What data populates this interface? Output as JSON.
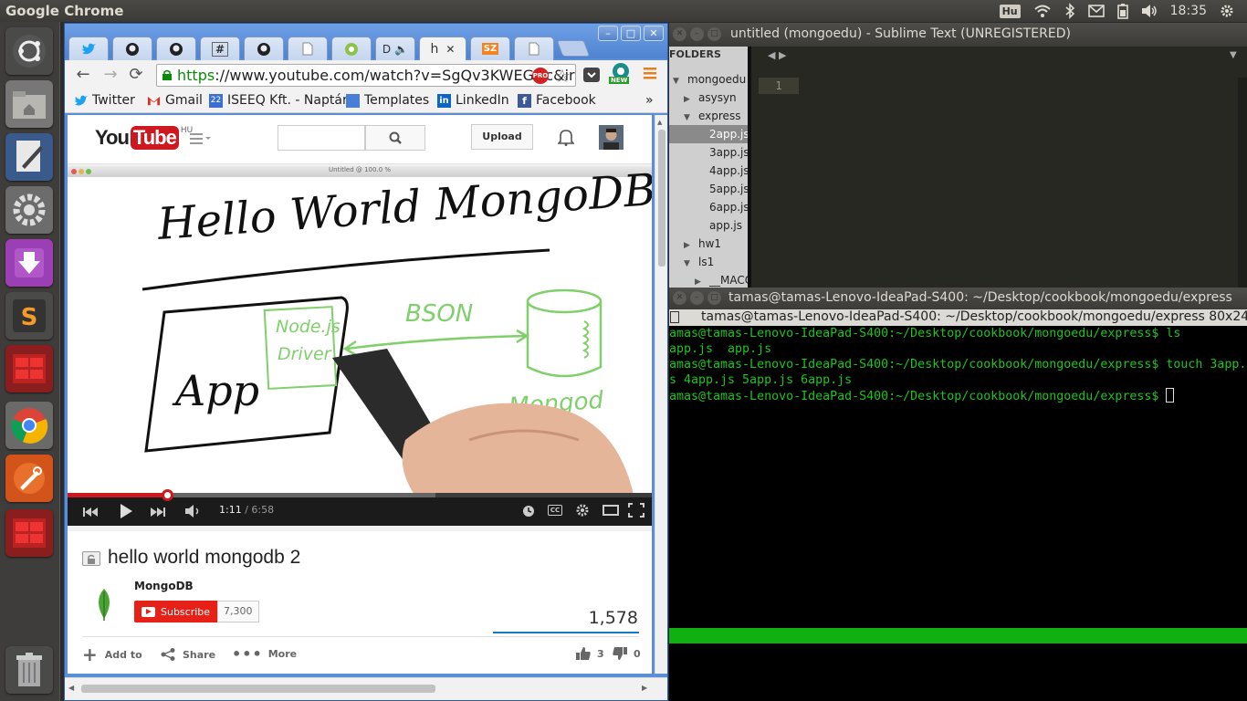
{
  "topbar": {
    "app_name": "Google Chrome",
    "keyboard": "Hu",
    "time": "18:35"
  },
  "launcher": {
    "items": [
      "ubuntu-dash",
      "files",
      "text-editor",
      "settings",
      "ubuntu-software",
      "sublime-text",
      "terminal",
      "chrome",
      "inkscape",
      "terminal-2",
      "trash"
    ]
  },
  "chrome": {
    "tabs": [
      "",
      "",
      "",
      "#",
      "",
      "",
      "",
      "D",
      "h",
      "SZ",
      ""
    ],
    "active_tab": "h",
    "url_https": "https",
    "url_rest": "://www.youtube.com/watch?v=SgQv3KWEGDc&ir",
    "bookmarks": [
      "Twitter",
      "Gmail",
      "ISEEQ Kft. - Naptár",
      "Templates",
      "LinkedIn",
      "Facebook"
    ],
    "bookmarks_more": "»",
    "new_badge": "NEW"
  },
  "youtube": {
    "logo_you": "You",
    "logo_tube": "Tube",
    "region": "HU",
    "upload": "Upload",
    "video_window_title": "Untitled @ 100.0 %",
    "time_current": "1:11",
    "time_total": "/ 6:58",
    "progress": 0.17,
    "buffered": 0.63,
    "title": "hello world mongodb 2",
    "channel": "MongoDB",
    "subscribe": "Subscribe",
    "subscriber_count": "7,300",
    "views": "1,578",
    "actions": {
      "add_to": "Add to",
      "share": "Share",
      "more": "More"
    },
    "likes": "3",
    "dislikes": "0",
    "whiteboard": {
      "heading": "Hello World MongoDB",
      "app": "App",
      "driver_line1": "Node.js",
      "driver_line2": "Driver",
      "bson": "BSON",
      "mongod": "Mongod"
    }
  },
  "sublime": {
    "title": "untitled (mongoedu) - Sublime Text (UNREGISTERED)",
    "folders_label": "FOLDERS",
    "tree": [
      {
        "label": "mongoedu",
        "arrow": "▼",
        "indent": 0
      },
      {
        "label": "asysyn",
        "arrow": "▶",
        "indent": 1
      },
      {
        "label": "express",
        "arrow": "▼",
        "indent": 1
      },
      {
        "label": "2app.js",
        "arrow": "",
        "indent": 2,
        "selected": true
      },
      {
        "label": "3app.js",
        "arrow": "",
        "indent": 2
      },
      {
        "label": "4app.js",
        "arrow": "",
        "indent": 2
      },
      {
        "label": "5app.js",
        "arrow": "",
        "indent": 2
      },
      {
        "label": "6app.js",
        "arrow": "",
        "indent": 2
      },
      {
        "label": "app.js",
        "arrow": "",
        "indent": 2
      },
      {
        "label": "hw1",
        "arrow": "▶",
        "indent": 1
      },
      {
        "label": "ls1",
        "arrow": "▼",
        "indent": 1
      },
      {
        "label": "__MACO",
        "arrow": "▶",
        "indent": 2
      }
    ],
    "line_number": "1"
  },
  "terminal": {
    "title": "tamas@tamas-Lenovo-IdeaPad-S400: ~/Desktop/cookbook/mongoedu/express",
    "tab_title": "tamas@tamas-Lenovo-IdeaPad-S400: ~/Desktop/cookbook/mongoedu/express 80x24",
    "lines": [
      "amas@tamas-Lenovo-IdeaPad-S400:~/Desktop/cookbook/mongoedu/express$ ls",
      "app.js  app.js",
      "amas@tamas-Lenovo-IdeaPad-S400:~/Desktop/cookbook/mongoedu/express$ touch 3app.",
      "s 4app.js 5app.js 6app.js",
      "amas@tamas-Lenovo-IdeaPad-S400:~/Desktop/cookbook/mongoedu/express$ "
    ]
  },
  "colors": {
    "chrome_frame": "#5a8fd6",
    "youtube_red": "#cc181e",
    "terminal_green": "#1ec41e",
    "sublime_bg": "#272822"
  }
}
